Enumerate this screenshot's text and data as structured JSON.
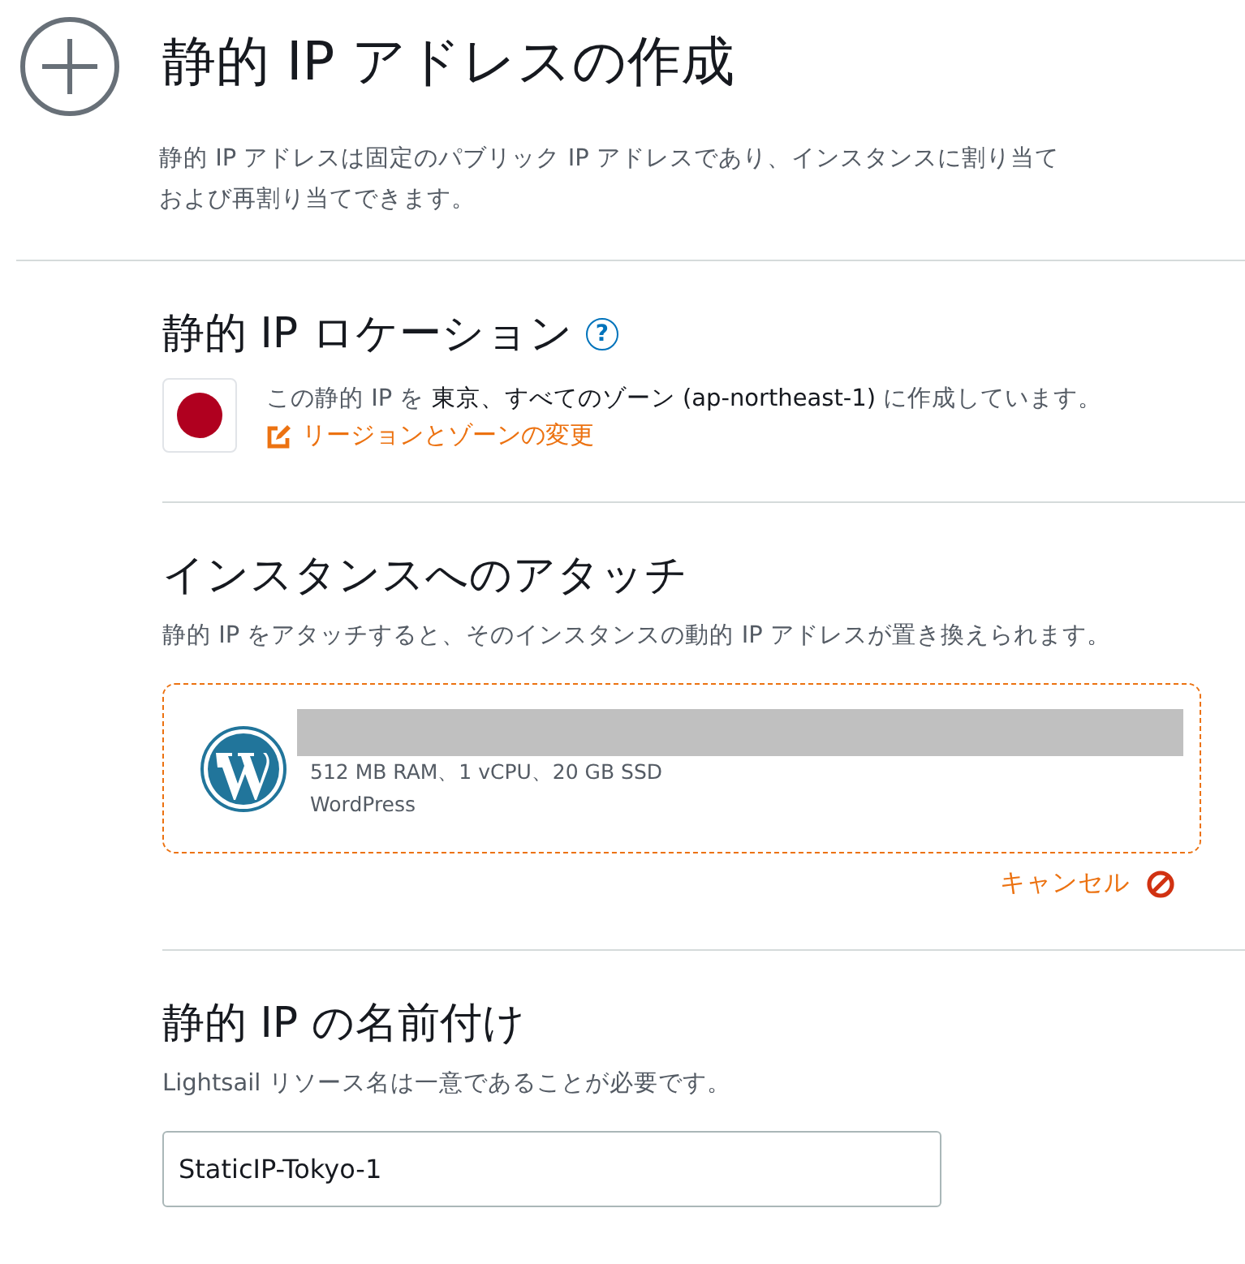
{
  "header": {
    "title": "静的 IP アドレスの作成",
    "description_lines": [
      "静的 IP アドレスは固定のパブリック IP アドレスであり、インスタンスに割り当て",
      "および再割り当てできます。"
    ]
  },
  "location": {
    "heading": "静的 IP ロケーション",
    "help": "?",
    "text_before": "この静的 IP を ",
    "region": "東京、すべてのゾーン (ap-northeast-1)",
    "text_after": " に作成しています。",
    "change_link": "リージョンとゾーンの変更"
  },
  "attach": {
    "heading": "インスタンスへのアタッチ",
    "description": "静的 IP をアタッチすると、そのインスタンスの動的 IP アドレスが置き換えられます。",
    "instance": {
      "specs": "512 MB RAM、1 vCPU、20 GB SSD",
      "blueprint": "WordPress"
    },
    "cancel": "キャンセル"
  },
  "naming": {
    "heading": "静的 IP の名前付け",
    "description": "Lightsail リソース名は一意であることが必要です。",
    "value": "StaticIP-Tokyo-1"
  }
}
